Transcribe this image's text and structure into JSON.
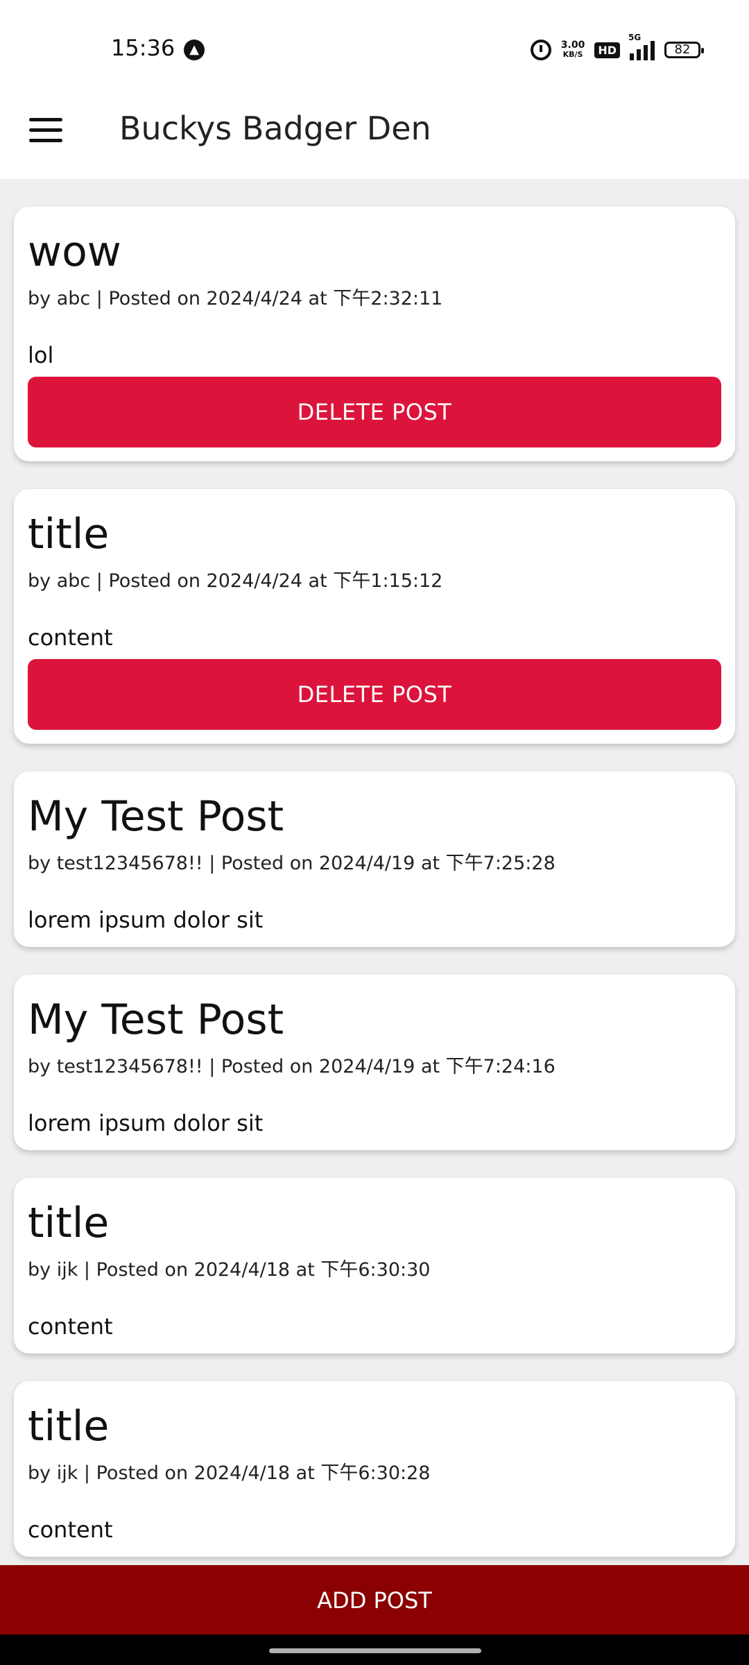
{
  "status_bar": {
    "time": "15:36",
    "net_speed_top": "3.00",
    "net_speed_bottom": "KB/S",
    "hd": "HD",
    "network": "5G",
    "battery": "82"
  },
  "app_bar": {
    "title": "Buckys Badger Den"
  },
  "posts": [
    {
      "title": "wow",
      "meta": "by abc | Posted on 2024/4/24 at 下午2:32:11",
      "content": "lol",
      "delete_label": "DELETE POST"
    },
    {
      "title": "title",
      "meta": "by abc | Posted on 2024/4/24 at 下午1:15:12",
      "content": "content",
      "delete_label": "DELETE POST"
    },
    {
      "title": "My Test Post",
      "meta": "by test12345678!! | Posted on 2024/4/19 at 下午7:25:28",
      "content": "lorem ipsum dolor sit"
    },
    {
      "title": "My Test Post",
      "meta": "by test12345678!! | Posted on 2024/4/19 at 下午7:24:16",
      "content": "lorem ipsum dolor sit"
    },
    {
      "title": "title",
      "meta": "by ijk | Posted on 2024/4/18 at 下午6:30:30",
      "content": "content"
    },
    {
      "title": "title",
      "meta": "by ijk | Posted on 2024/4/18 at 下午6:30:28",
      "content": "content"
    }
  ],
  "footer": {
    "add_post_label": "ADD POST"
  },
  "colors": {
    "delete_button": "#DC143C",
    "add_post_button": "#8B0000"
  }
}
